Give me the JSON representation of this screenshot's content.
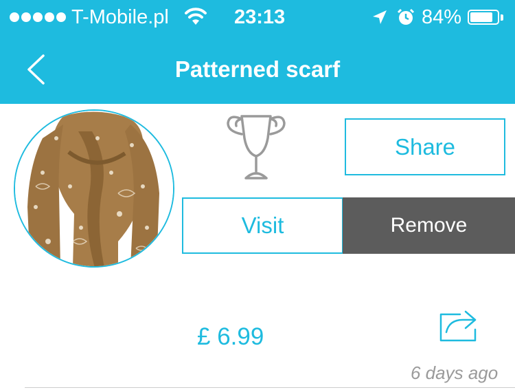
{
  "status_bar": {
    "carrier": "T-Mobile.pl",
    "time": "23:13",
    "battery_percent": "84%",
    "battery_level": 0.84,
    "signal_dots": 5
  },
  "nav": {
    "title": "Patterned scarf",
    "back_icon": "chevron-left-icon"
  },
  "product": {
    "image_icon": "scarf-photo",
    "award_icon": "trophy-icon",
    "price": "£ 6.99",
    "timestamp": "6 days ago",
    "share_icon": "share-arrow-icon"
  },
  "actions": {
    "share_label": "Share",
    "visit_label": "Visit",
    "remove_label": "Remove"
  },
  "colors": {
    "accent": "#1ebbdf",
    "remove_bg": "#5c5c5c",
    "muted_text": "#9a9a9a"
  }
}
